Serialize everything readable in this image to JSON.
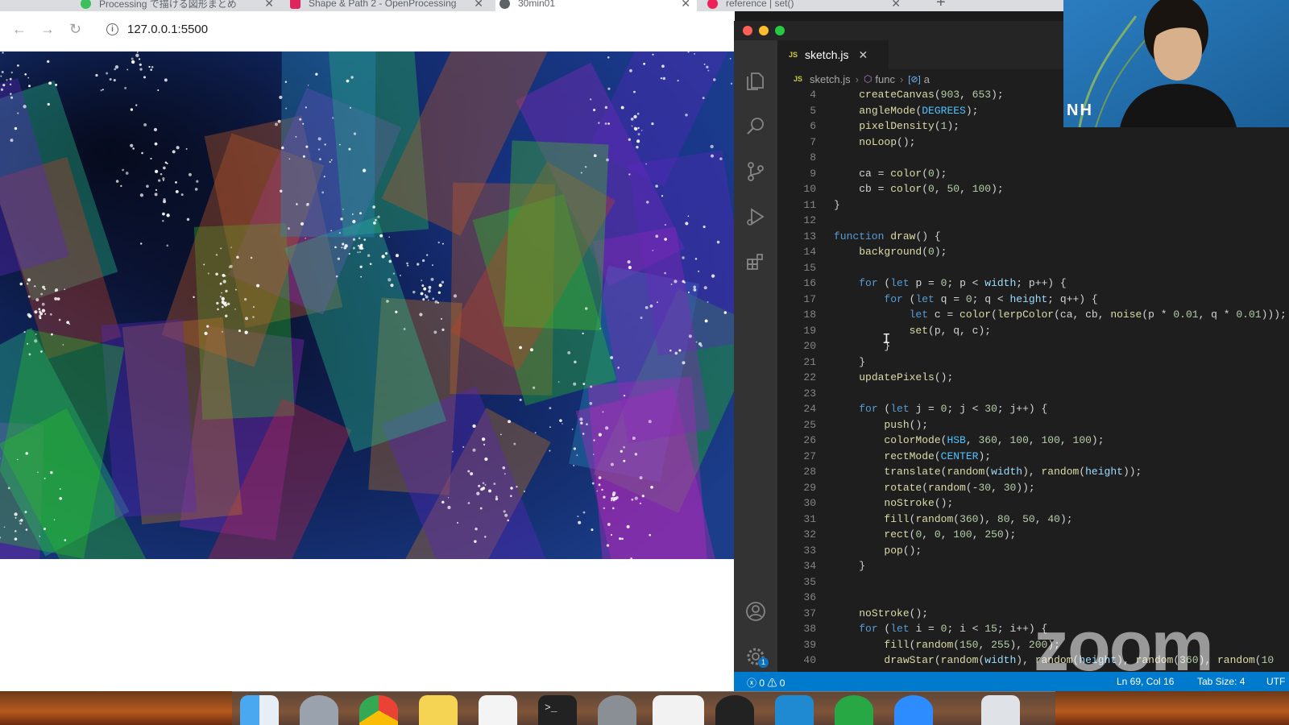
{
  "browser": {
    "tabs": [
      {
        "label": "Processing で描ける図形まとめ"
      },
      {
        "label": "Shape & Path 2 - OpenProcessing"
      },
      {
        "label": "30min01"
      },
      {
        "label": "reference | set()"
      }
    ],
    "url": "127.0.0.1:5500"
  },
  "vscode": {
    "tab_label": "sketch.js",
    "tab_badge": "JS",
    "breadcrumb": {
      "file": "sketch.js",
      "function": "func",
      "variable": "a"
    },
    "settings_badge": "1",
    "status": {
      "errors": "0",
      "warnings": "0",
      "position": "Ln 69, Col 16",
      "tab_size": "Tab Size: 4",
      "encoding": "UTF"
    },
    "code_lines": [
      {
        "n": "4",
        "text": "    createCanvas(903, 653);"
      },
      {
        "n": "5",
        "text": "    angleMode(DEGREES);"
      },
      {
        "n": "6",
        "text": "    pixelDensity(1);"
      },
      {
        "n": "7",
        "text": "    noLoop();"
      },
      {
        "n": "8",
        "text": ""
      },
      {
        "n": "9",
        "text": "    ca = color(0);"
      },
      {
        "n": "10",
        "text": "    cb = color(0, 50, 100);"
      },
      {
        "n": "11",
        "text": "}"
      },
      {
        "n": "12",
        "text": ""
      },
      {
        "n": "13",
        "text": "function draw() {"
      },
      {
        "n": "14",
        "text": "    background(0);"
      },
      {
        "n": "15",
        "text": ""
      },
      {
        "n": "16",
        "text": "    for (let p = 0; p < width; p++) {"
      },
      {
        "n": "17",
        "text": "        for (let q = 0; q < height; q++) {"
      },
      {
        "n": "18",
        "text": "            let c = color(lerpColor(ca, cb, noise(p * 0.01, q * 0.01)));"
      },
      {
        "n": "19",
        "text": "            set(p, q, c);"
      },
      {
        "n": "20",
        "text": "        }"
      },
      {
        "n": "21",
        "text": "    }"
      },
      {
        "n": "22",
        "text": "    updatePixels();"
      },
      {
        "n": "23",
        "text": ""
      },
      {
        "n": "24",
        "text": "    for (let j = 0; j < 30; j++) {"
      },
      {
        "n": "25",
        "text": "        push();"
      },
      {
        "n": "26",
        "text": "        colorMode(HSB, 360, 100, 100, 100);"
      },
      {
        "n": "27",
        "text": "        rectMode(CENTER);"
      },
      {
        "n": "28",
        "text": "        translate(random(width), random(height));"
      },
      {
        "n": "29",
        "text": "        rotate(random(-30, 30));"
      },
      {
        "n": "30",
        "text": "        noStroke();"
      },
      {
        "n": "31",
        "text": "        fill(random(360), 80, 50, 40);"
      },
      {
        "n": "32",
        "text": "        rect(0, 0, 100, 250);"
      },
      {
        "n": "33",
        "text": "        pop();"
      },
      {
        "n": "34",
        "text": "    }"
      },
      {
        "n": "35",
        "text": ""
      },
      {
        "n": "36",
        "text": ""
      },
      {
        "n": "37",
        "text": "    noStroke();"
      },
      {
        "n": "38",
        "text": "    for (let i = 0; i < 15; i++) {"
      },
      {
        "n": "39",
        "text": "        fill(random(150, 255), 200);"
      },
      {
        "n": "40",
        "text": "        drawStar(random(width), random(height), random(360), random(10"
      }
    ]
  },
  "webcam": {
    "name": "NH"
  },
  "watermark": "zoom",
  "colors": {
    "vscode_bg": "#1e1e1e",
    "statusbar": "#007acc",
    "keyword": "#569cd6",
    "function": "#dcdcaa",
    "constant": "#4fc1ff",
    "number": "#b5cea8"
  }
}
